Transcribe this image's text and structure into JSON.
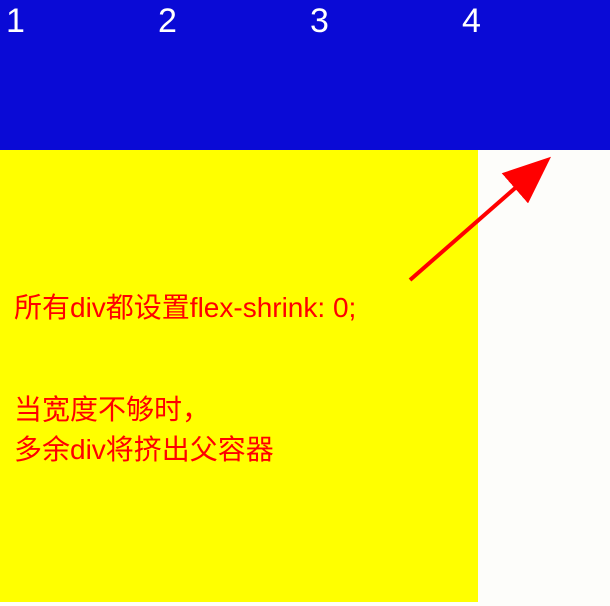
{
  "flex_items": {
    "item1": "1",
    "item2": "2",
    "item3": "3",
    "item4": "4"
  },
  "annotation": {
    "line1": "所有div都设置flex-shrink: 0;",
    "line2": "当宽度不够时，",
    "line3": "多余div将挤出父容器"
  }
}
